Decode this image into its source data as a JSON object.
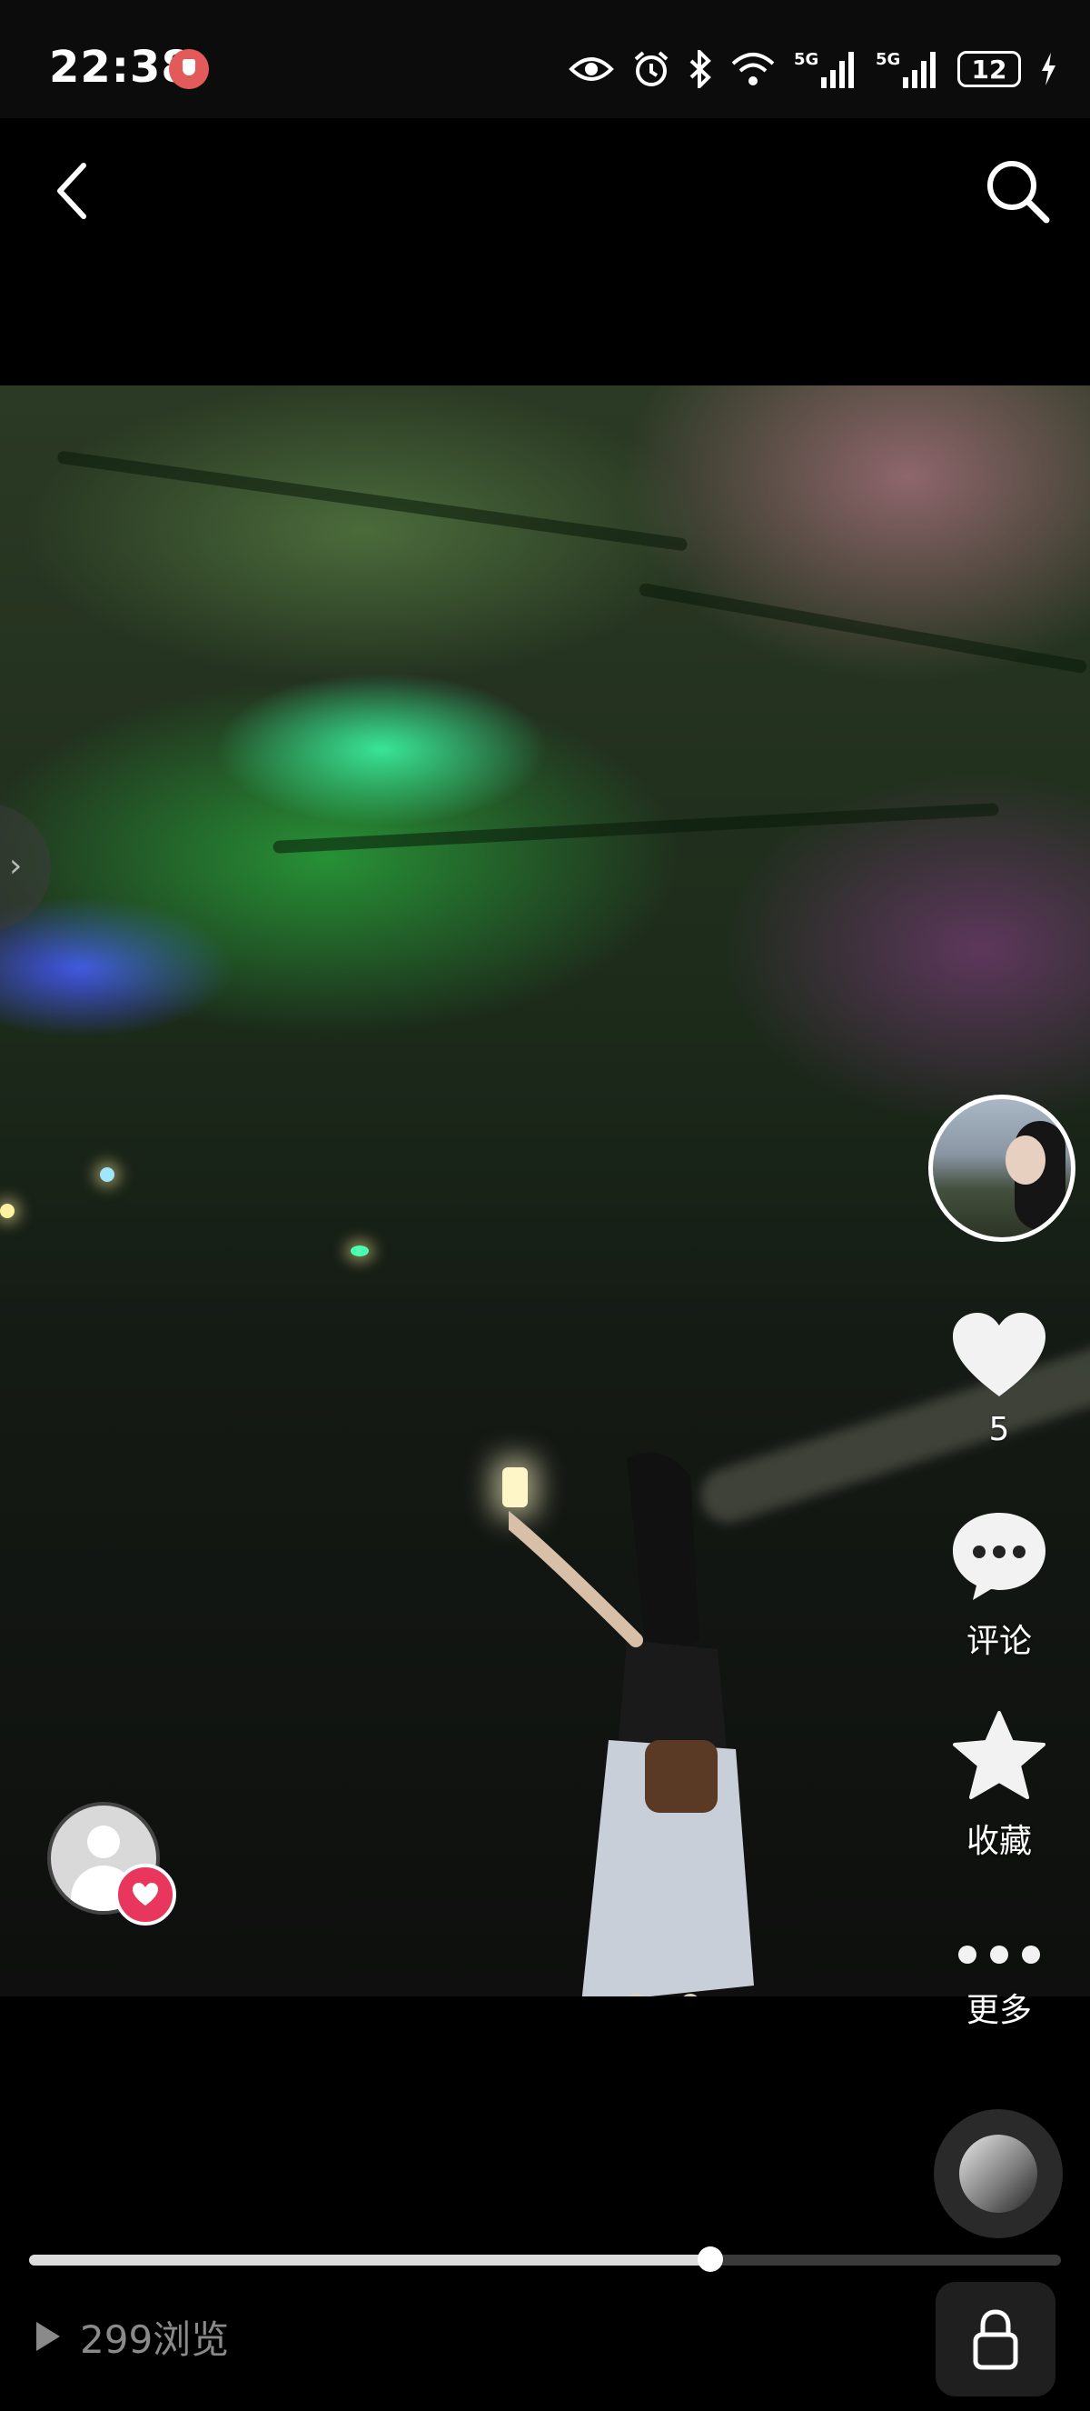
{
  "status_bar": {
    "time": "22:38",
    "icons": [
      "shield-icon",
      "eye-icon",
      "alarm-icon",
      "bluetooth-icon",
      "wifi-icon",
      "signal-5g-icon",
      "signal-5g-icon",
      "battery-icon",
      "charging-icon"
    ],
    "network_1": "5G",
    "network_2": "5G",
    "battery_level": "12"
  },
  "header": {
    "back_icon": "chevron-left-icon",
    "search_icon": "search-icon"
  },
  "actions": {
    "like_count": "5",
    "comment_label": "评论",
    "favorite_label": "收藏",
    "more_label": "更多"
  },
  "playback": {
    "progress_fraction": 0.66,
    "views_text": "299浏览"
  },
  "colors": {
    "like_heart": "#ffffff",
    "badge_red": "#e8365d",
    "progress_fill": "#dcdcdc",
    "progress_track": "#3a3a3a"
  }
}
